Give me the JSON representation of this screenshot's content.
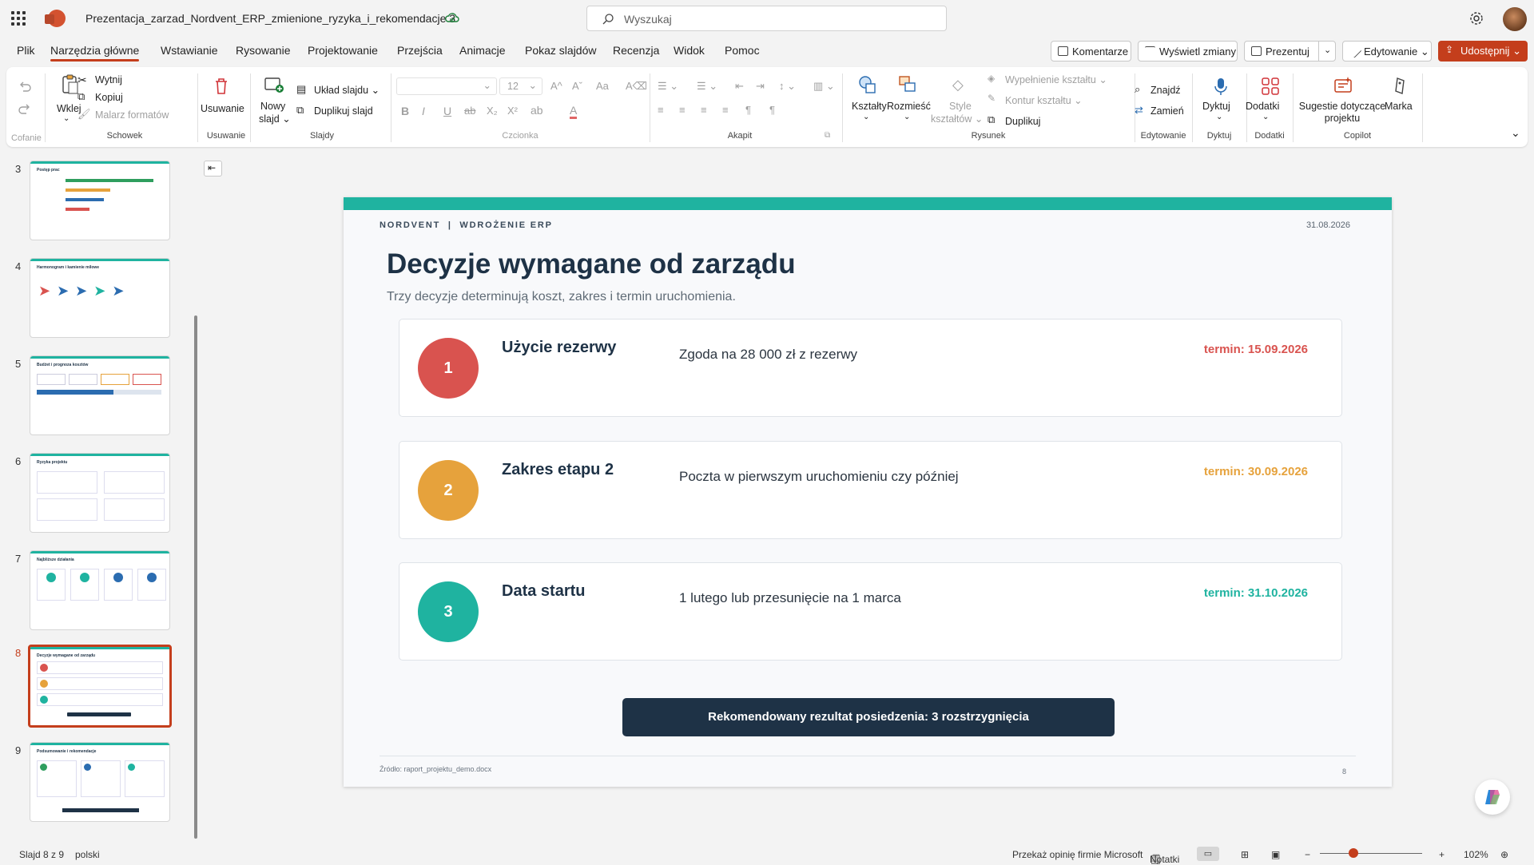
{
  "app": {
    "doc_title": "Prezentacja_zarzad_Nordvent_ERP_zmienione_ryzyka_i_rekomendacje 3",
    "search_placeholder": "Wyszukaj"
  },
  "menu": {
    "tabs": [
      "Plik",
      "Narzędzia główne",
      "Wstawianie",
      "Rysowanie",
      "Projektowanie",
      "Przejścia",
      "Animacje",
      "Pokaz slajdów",
      "Recenzja",
      "Widok",
      "Pomoc"
    ],
    "comments": "Komentarze",
    "show_changes": "Wyświetl zmiany",
    "present": "Prezentuj",
    "editing": "Edytowanie",
    "share": "Udostępnij"
  },
  "ribbon": {
    "undo_group": "Cofanie",
    "paste": "Wklej",
    "cut": "Wytnij",
    "copy": "Kopiuj",
    "format_painter": "Malarz formatów",
    "clipboard_group": "Schowek",
    "delete": "Usuwanie",
    "delete_group": "Usuwanie",
    "new_slide_1": "Nowy",
    "new_slide_2": "slajd",
    "layout": "Układ slajdu",
    "duplicate_slide": "Duplikuj slajd",
    "slides_group": "Slajdy",
    "font_size": "12",
    "font_group": "Czcionka",
    "paragraph_group": "Akapit",
    "shapes": "Kształty",
    "arrange": "Rozmieść",
    "shape_styles_1": "Style",
    "shape_styles_2": "kształtów",
    "shape_fill": "Wypełnienie kształtu",
    "shape_outline": "Kontur kształtu",
    "duplicate": "Duplikuj",
    "drawing_group": "Rysunek",
    "find": "Znajdź",
    "replace": "Zamień",
    "editing_group": "Edytowanie",
    "dictate": "Dyktuj",
    "dictate_group": "Dyktuj",
    "addins": "Dodatki",
    "addins_group": "Dodatki",
    "suggestions_1": "Sugestie dotyczące",
    "suggestions_2": "projektu",
    "brand": "Marka",
    "copilot_group": "Copilot"
  },
  "thumbnails": [
    {
      "num": "3",
      "title": "Postęp prac"
    },
    {
      "num": "4",
      "title": "Harmonogram i kamienie milowe"
    },
    {
      "num": "5",
      "title": "Budżet i prognoza kosztów"
    },
    {
      "num": "6",
      "title": "Ryzyka projektu"
    },
    {
      "num": "7",
      "title": "Najbliższe działania"
    },
    {
      "num": "8",
      "title": "Decyzje wymagane od zarządu"
    },
    {
      "num": "9",
      "title": "Podsumowanie i rekomendacje"
    }
  ],
  "slide": {
    "kicker": "NORDVENT  |  WDROŻENIE ERP",
    "date": "31.08.2026",
    "title": "Decyzje wymagane od zarządu",
    "subtitle": "Trzy decyzje determinują koszt, zakres i termin uruchomienia.",
    "decisions": [
      {
        "num": "1",
        "title": "Użycie rezerwy",
        "desc": "Zgoda na 28 000 zł z rezerwy",
        "term": "termin: 15.09.2026",
        "color": "#d9534f"
      },
      {
        "num": "2",
        "title": "Zakres etapu 2",
        "desc": "Poczta w pierwszym uruchomieniu czy później",
        "term": "termin: 30.09.2026",
        "color": "#e6a23c"
      },
      {
        "num": "3",
        "title": "Data startu",
        "desc": "1 lutego lub przesunięcie na 1 marca",
        "term": "termin: 31.10.2026",
        "color": "#1fb3a0"
      }
    ],
    "banner": "Rekomendowany rezultat posiedzenia: 3 rozstrzygnięcia",
    "source": "Źródło: raport_projektu_demo.docx",
    "page": "8"
  },
  "status": {
    "slide_of": "Slajd 8 z 9",
    "language": "polski",
    "feedback": "Przekaż opinię firmie Microsoft",
    "notes": "Notatki",
    "zoom": "102%"
  },
  "colors": {
    "accent": "#c43e1c",
    "teal": "#1fb3a0",
    "navy": "#1e3246"
  }
}
